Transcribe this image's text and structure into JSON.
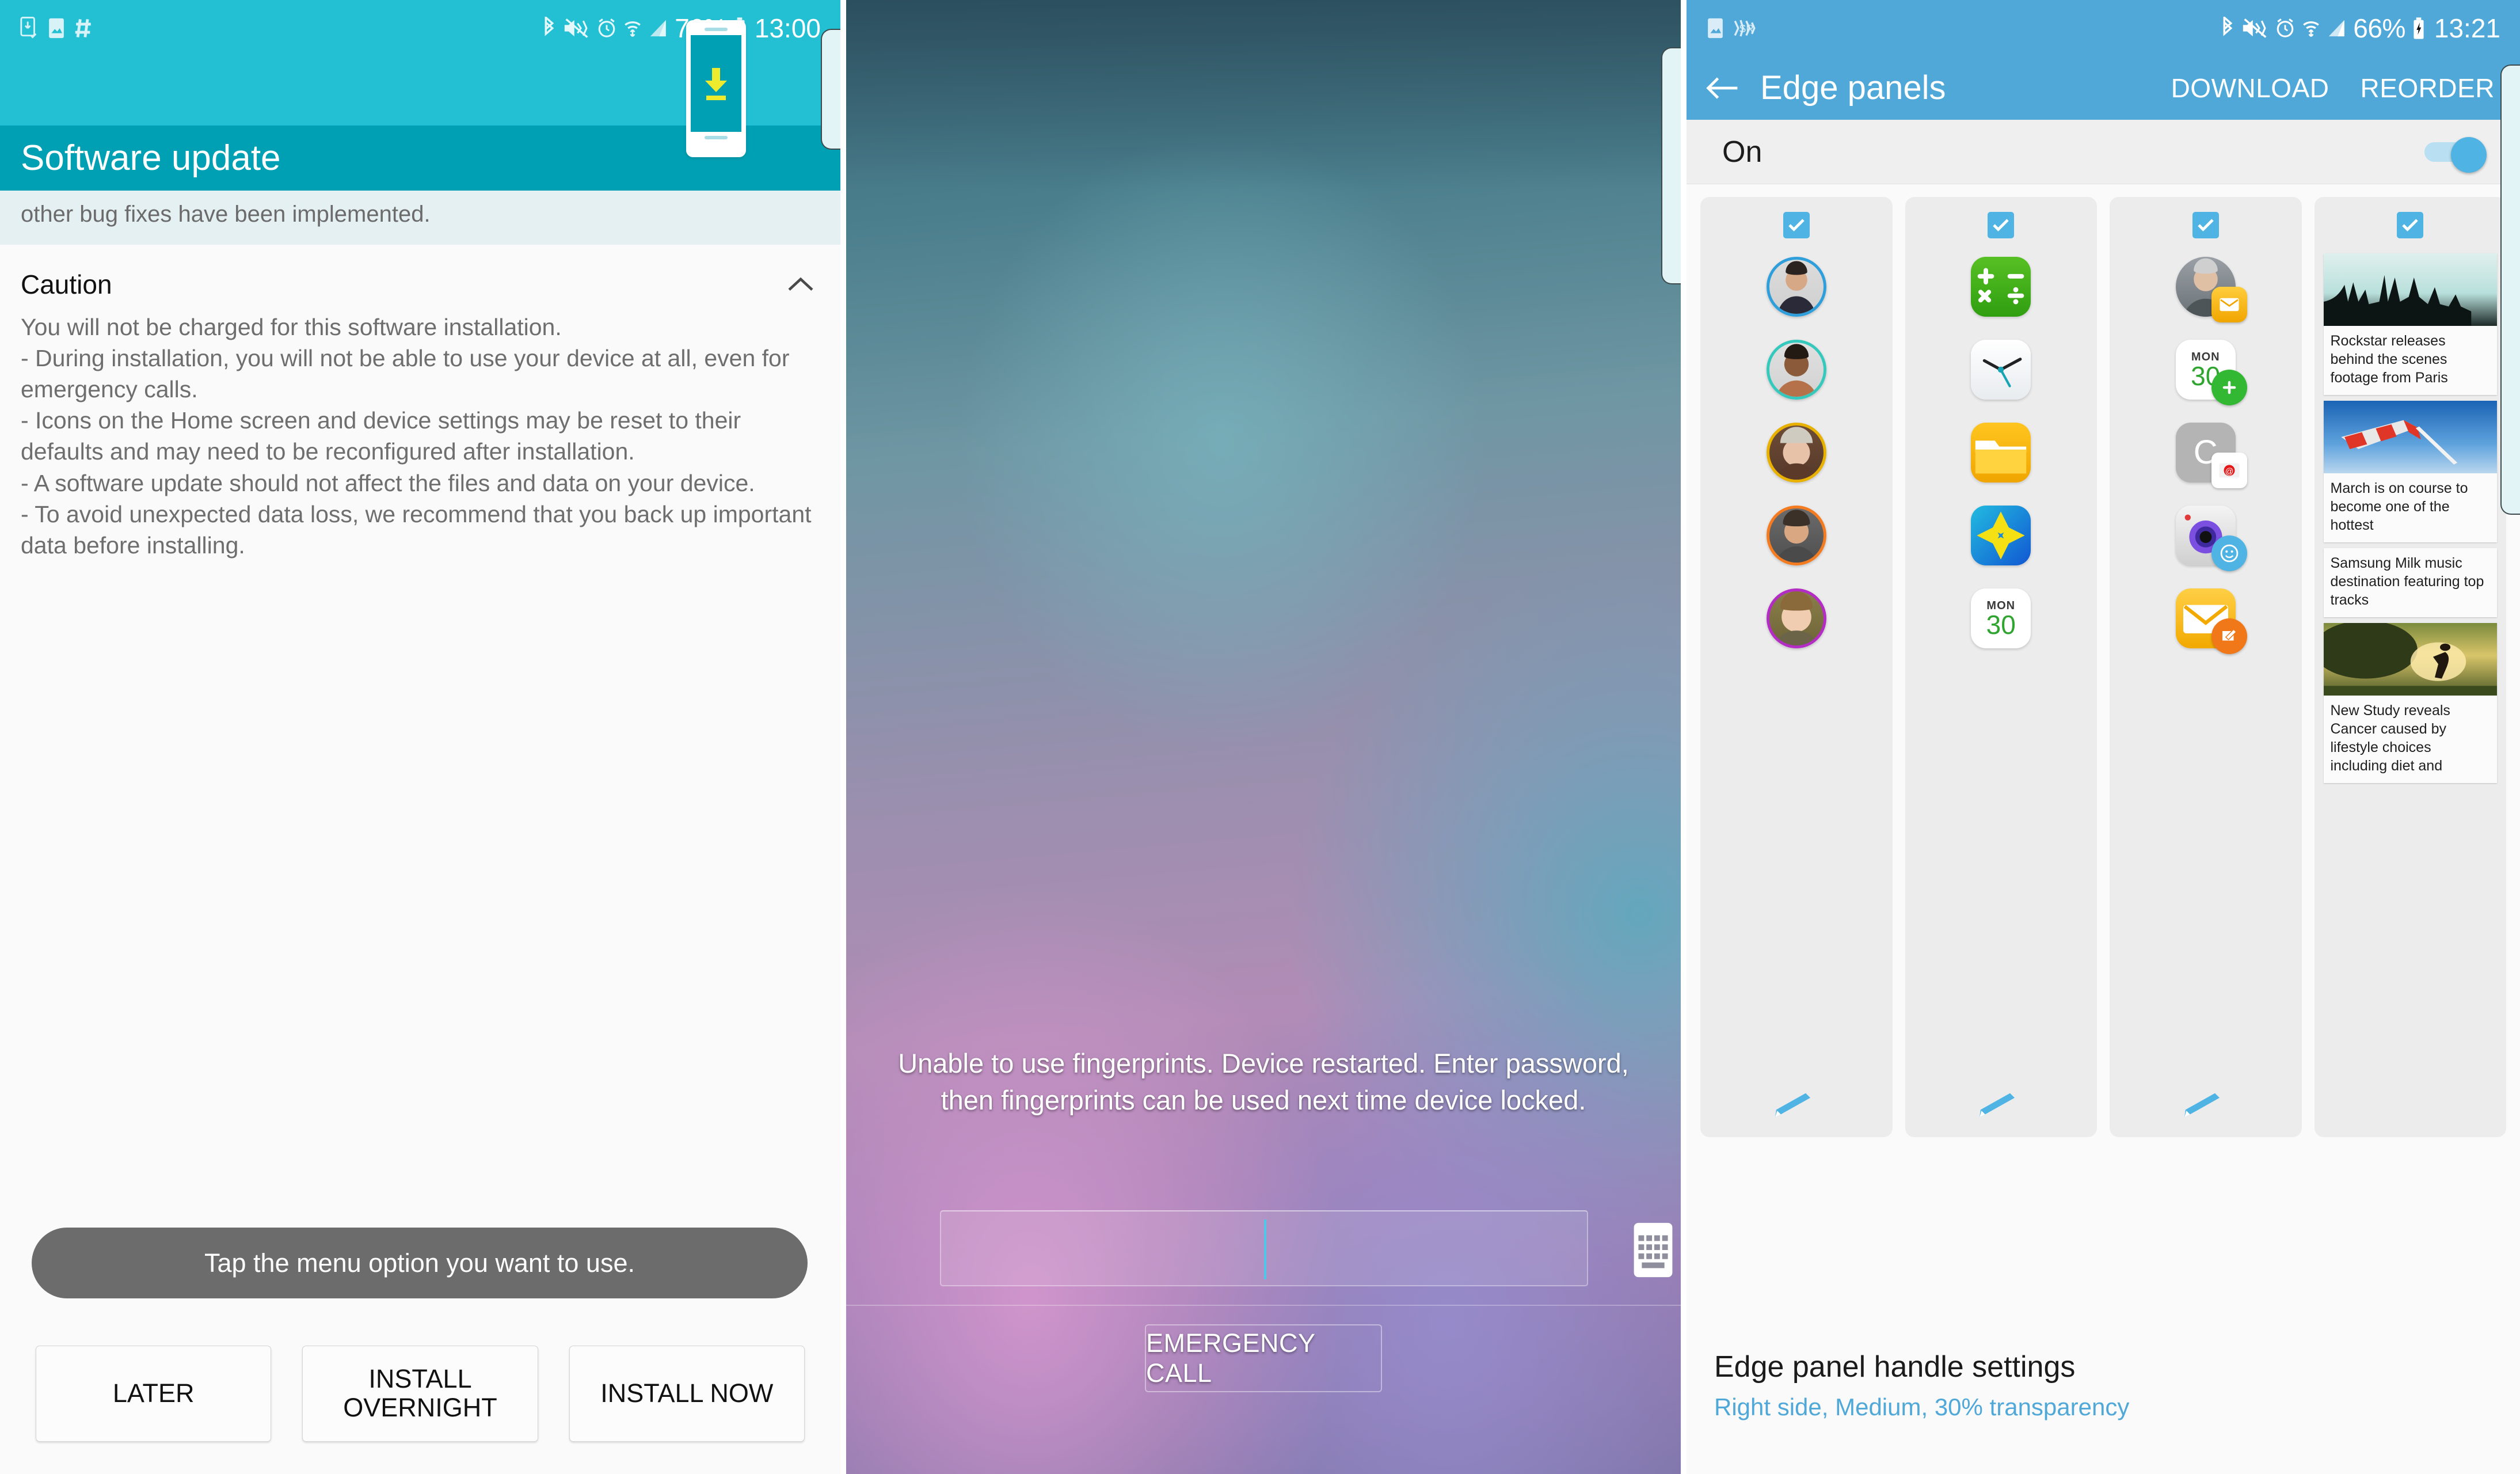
{
  "panel1": {
    "statusbar": {
      "left_icons": [
        "screen-capture-icon",
        "image-saved-icon",
        "hashtag-icon"
      ],
      "right_icons": [
        "bluetooth-icon",
        "mute-vibrate-icon",
        "alarm-icon",
        "wifi-icon",
        "signal-icon"
      ],
      "battery_percent": "76%",
      "clock": "13:00"
    },
    "hero": {
      "device_icon": "phone-download-icon"
    },
    "title": "Software update",
    "scroll_note": "other bug fixes have been implemented.",
    "caution_heading": "Caution",
    "collapse_icon": "chevron-up-icon",
    "caution_body": "You will not be charged for this software installation.\n- During installation, you will not be able to use your device at all, even for emergency calls.\n- Icons on the Home screen and device settings may be reset to their defaults and may need to be reconfigured after installation.\n- A software update should not affect the files and data on your device.\n- To avoid unexpected data loss, we recommend that you back up important data before installing.",
    "toast": "Tap the menu option you want to use.",
    "buttons": {
      "later": "LATER",
      "install_overnight": "INSTALL OVERNIGHT",
      "install_now": "INSTALL NOW"
    }
  },
  "panel2": {
    "message": "Unable to use fingerprints. Device restarted. Enter password, then fingerprints can be used next time device locked.",
    "password_value": "",
    "password_placeholder": "",
    "keyboard_icon": "keyboard-icon",
    "emergency_call": "EMERGENCY CALL"
  },
  "panel3": {
    "statusbar": {
      "left_icons": [
        "image-saved-icon",
        "screen-recorder-icon"
      ],
      "right_icons": [
        "bluetooth-icon",
        "mute-vibrate-icon",
        "alarm-icon",
        "wifi-icon",
        "signal-icon"
      ],
      "battery_percent": "66%",
      "charging_icon": "charging-bolt-icon",
      "clock": "13:21"
    },
    "appbar": {
      "back_icon": "back-arrow-icon",
      "title": "Edge panels",
      "download": "DOWNLOAD",
      "reorder": "REORDER"
    },
    "toggle": {
      "label": "On",
      "checked": true
    },
    "columns": [
      {
        "name": "people-edge",
        "checked": true,
        "kind": "avatars",
        "items": [
          {
            "icon": "contact-avatar-1",
            "ring": "#2f9fdc"
          },
          {
            "icon": "contact-avatar-2",
            "ring": "#35c9bd"
          },
          {
            "icon": "contact-avatar-3",
            "ring": "#e8b100"
          },
          {
            "icon": "contact-avatar-4",
            "ring": "#f47b20"
          },
          {
            "icon": "contact-avatar-5",
            "ring": "#b32cc4"
          }
        ],
        "edit_icon": "pencil-icon"
      },
      {
        "name": "apps-edge",
        "checked": true,
        "kind": "apps",
        "items": [
          {
            "icon": "calculator-icon"
          },
          {
            "icon": "clock-icon"
          },
          {
            "icon": "my-files-icon"
          },
          {
            "icon": "gallery-icon"
          },
          {
            "icon": "calendar-icon",
            "day": "MON",
            "date": "30"
          }
        ],
        "edit_icon": "pencil-icon"
      },
      {
        "name": "tasks-edge",
        "checked": true,
        "kind": "tasks",
        "items": [
          {
            "icon": "contact-avatar-6",
            "badge": "email-badge-icon"
          },
          {
            "icon": "calendar-icon",
            "day": "MON",
            "date": "30",
            "badge": "add-event-badge-icon"
          },
          {
            "icon": "contacts-letter-icon",
            "letter": "C",
            "badge": "at-mail-badge-icon"
          },
          {
            "icon": "camera-icon",
            "badge": "selfie-badge-icon"
          },
          {
            "icon": "email-icon",
            "badge": "compose-badge-icon"
          }
        ],
        "edit_icon": "pencil-icon"
      },
      {
        "name": "news-edge",
        "checked": true,
        "kind": "news",
        "items": [
          {
            "image": "concert-crowd-photo",
            "headline": "Rockstar releases behind the scenes footage from Paris"
          },
          {
            "image": "windsock-photo",
            "headline": "March is on course to become one of the hottest"
          },
          {
            "image": null,
            "headline": "Samsung Milk music destination featuring top tracks"
          },
          {
            "image": "runner-sunset-photo",
            "headline": "New Study reveals Cancer caused by lifestyle choices including diet and"
          }
        ]
      }
    ],
    "footer": {
      "title": "Edge panel handle settings",
      "subtitle": "Right side, Medium, 30% transparency"
    }
  }
}
